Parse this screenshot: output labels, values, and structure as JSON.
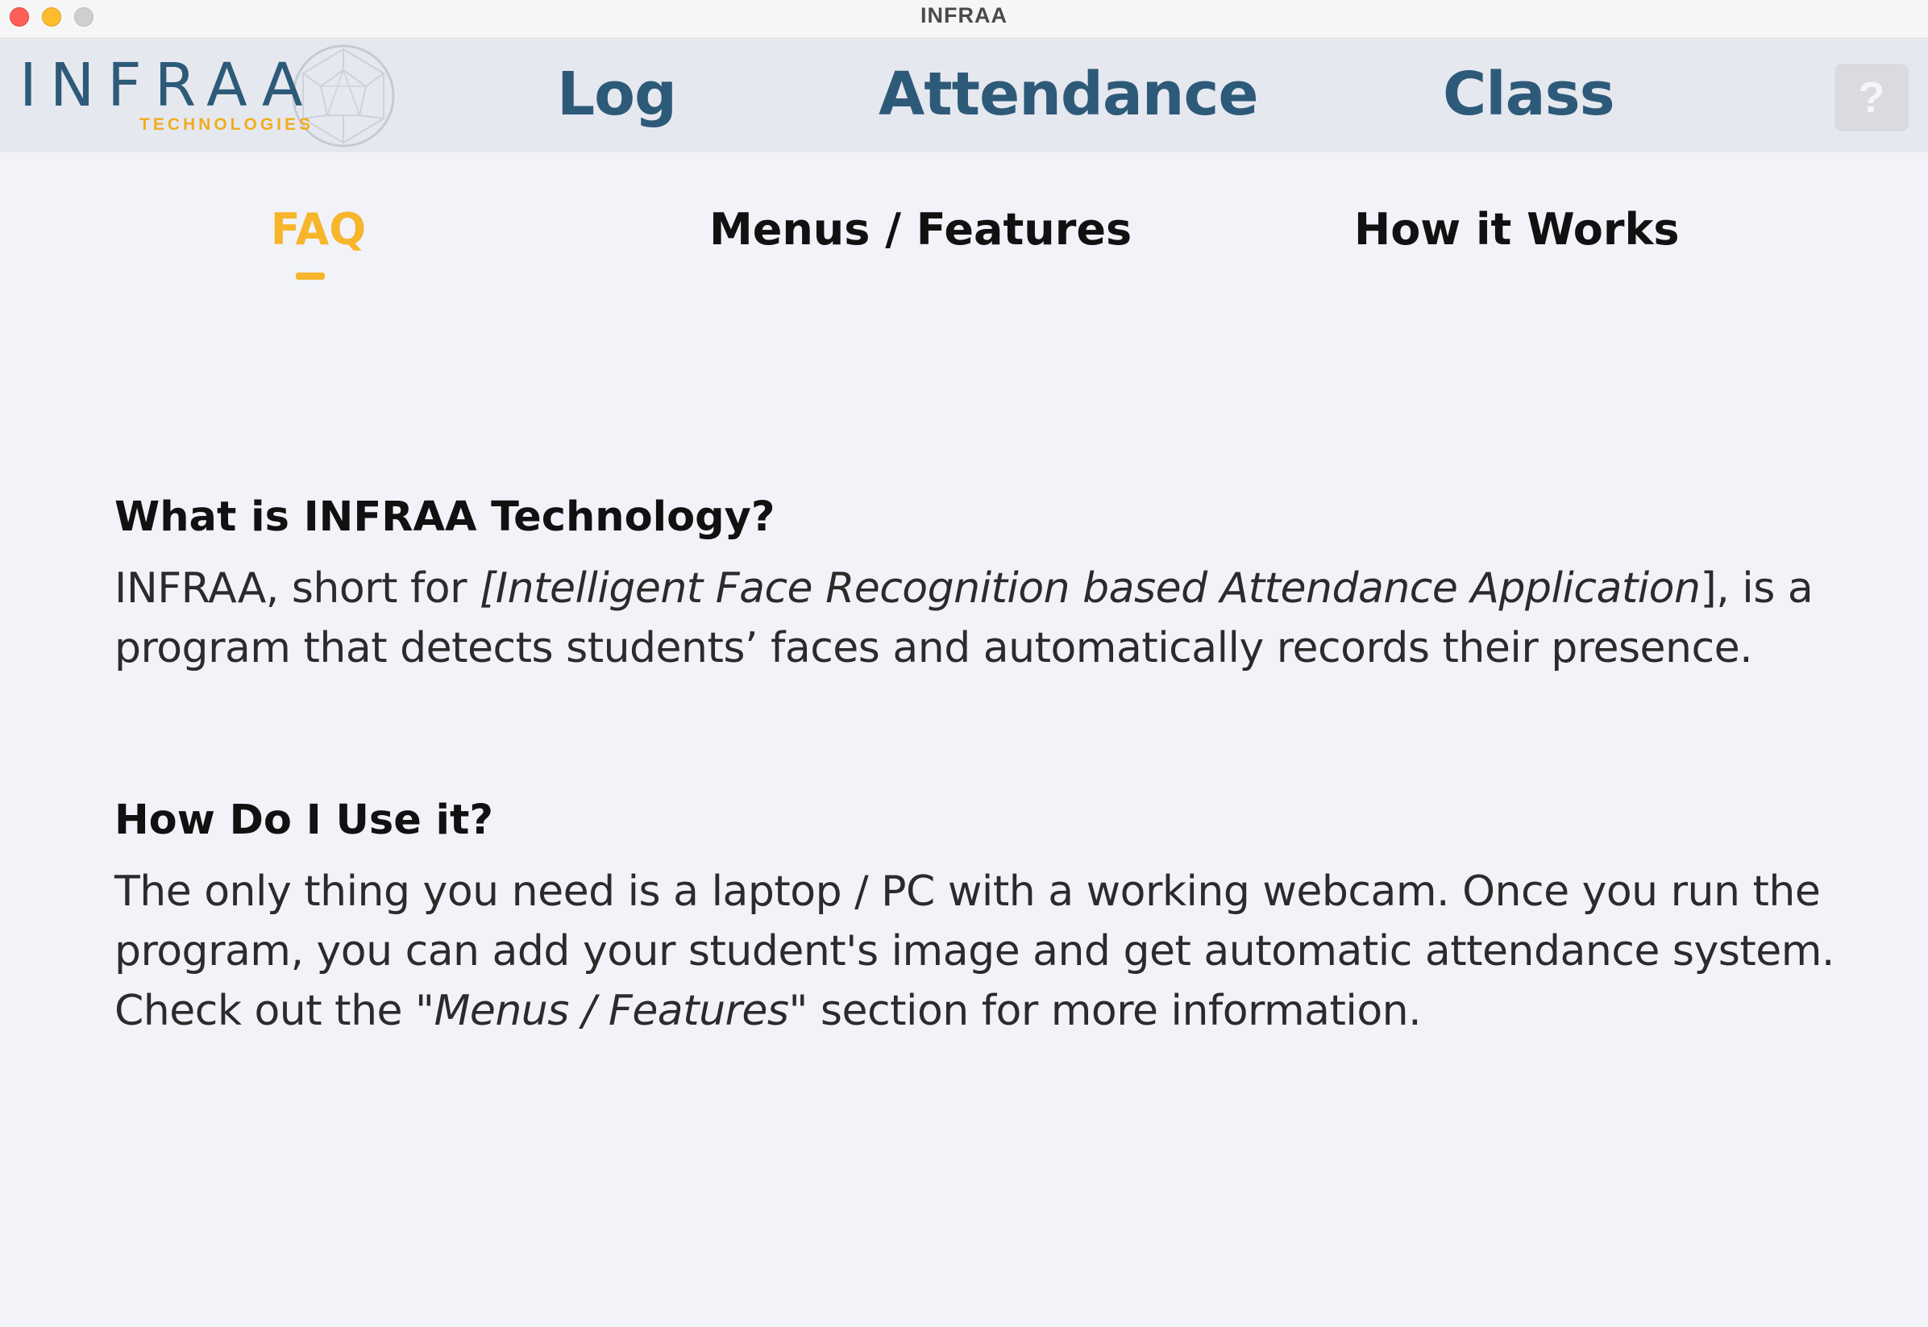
{
  "window": {
    "title": "INFRAA"
  },
  "logo": {
    "wordmark": "INFRAA",
    "subtitle": "TECHNOLOGIES"
  },
  "topnav": {
    "items": [
      {
        "label": "Log"
      },
      {
        "label": "Attendance"
      },
      {
        "label": "Class"
      }
    ],
    "help_label": "?"
  },
  "subtabs": {
    "active": "FAQ",
    "items": [
      {
        "label": "FAQ"
      },
      {
        "label": "Menus / Features"
      },
      {
        "label": "How it Works"
      }
    ]
  },
  "faq": [
    {
      "question": "What is INFRAA Technology?",
      "answer_pre": "INFRAA, short for ",
      "answer_italic": "[Intelligent Face Recognition based Attendance Application",
      "answer_post": "], is a program that detects students’ faces and automatically records their presence."
    },
    {
      "question": "How Do I Use it?",
      "answer_pre": "The only thing you need is a laptop / PC with a working webcam. Once you run the program, you can add your student's image and get automatic attendance system. Check out the ",
      "answer_italic": "\"Menus / Features\"",
      "answer_post": " section for more information."
    }
  ],
  "colors": {
    "brand_blue": "#2e5a79",
    "accent_yellow": "#f7b52c",
    "background": "#f2f3f8",
    "nav_background": "#e6e8ef"
  }
}
